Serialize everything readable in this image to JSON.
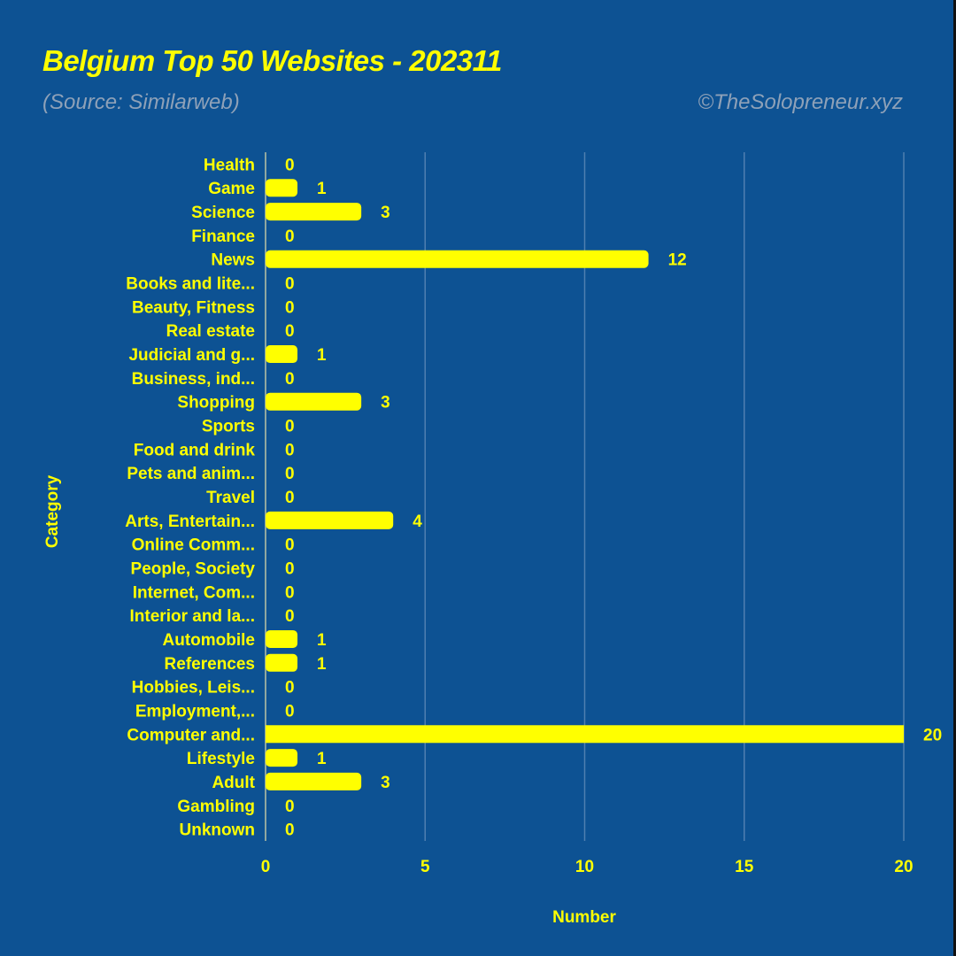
{
  "header": {
    "title": "Belgium Top 50 Websites - 202311",
    "source": "(Source: Similarweb)",
    "credit": "©TheSolopreneur.xyz"
  },
  "colors": {
    "background": "#0d5293",
    "bar": "#ffff00",
    "text": "#ffff00",
    "subtitle": "#8ea1b8",
    "grid": "#4f7fb0"
  },
  "chart_data": {
    "type": "bar",
    "orientation": "horizontal",
    "title": "Belgium Top 50 Websites - 202311",
    "subtitle": "(Source: Similarweb)",
    "annotation": "©TheSolopreneur.xyz",
    "xlabel": "Number",
    "ylabel": "Category",
    "xlim": [
      0,
      20
    ],
    "xticks": [
      0,
      5,
      10,
      15,
      20
    ],
    "grid": "vertical",
    "categories": [
      "Health",
      "Game",
      "Science",
      "Finance",
      "News",
      "Books and lite...",
      "Beauty, Fitness",
      "Real estate",
      "Judicial and g...",
      "Business, ind...",
      "Shopping",
      "Sports",
      "Food and drink",
      "Pets and anim...",
      "Travel",
      "Arts, Entertain...",
      "Online Comm...",
      "People, Society",
      "Internet, Com...",
      "Interior and la...",
      "Automobile",
      "References",
      "Hobbies, Leis...",
      "Employment,...",
      "Computer and...",
      "Lifestyle",
      "Adult",
      "Gambling",
      "Unknown"
    ],
    "values": [
      0,
      1,
      3,
      0,
      12,
      0,
      0,
      0,
      1,
      0,
      3,
      0,
      0,
      0,
      0,
      4,
      0,
      0,
      0,
      0,
      1,
      1,
      0,
      0,
      20,
      1,
      3,
      0,
      0
    ]
  }
}
